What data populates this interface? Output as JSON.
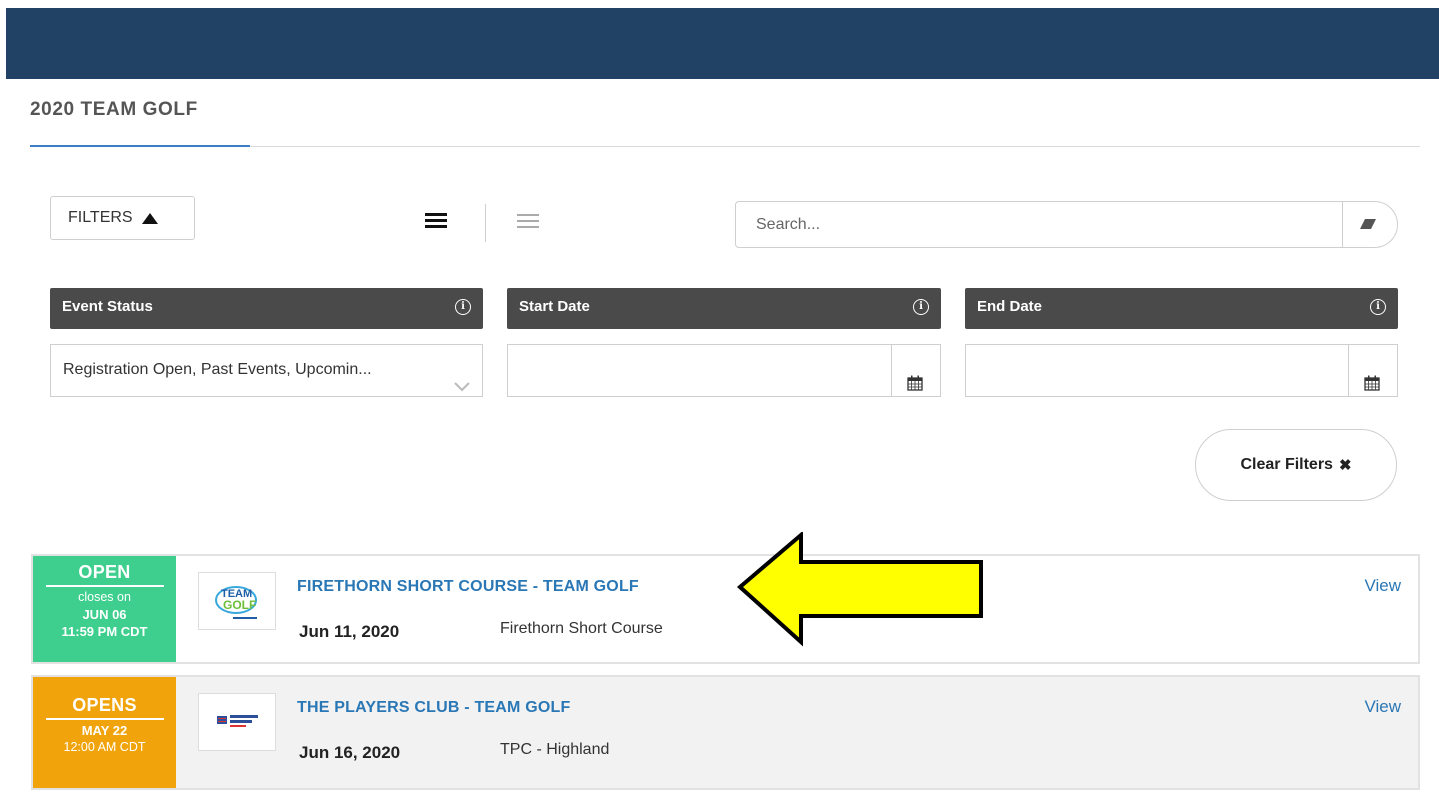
{
  "page_title": "2020 TEAM GOLF",
  "toolbar": {
    "filters_label": "FILTERS",
    "search_placeholder": "Search...",
    "search_value": ""
  },
  "filters": [
    {
      "header": "Event Status",
      "value": "Registration Open, Past Events, Upcomin..."
    },
    {
      "header": "Start Date",
      "value": ""
    },
    {
      "header": "End Date",
      "value": ""
    }
  ],
  "clear_filters_label": "Clear Filters",
  "events": [
    {
      "badge": {
        "status": "OPEN",
        "line1": "closes on",
        "line2": "JUN 06",
        "line3": "11:59 PM CDT",
        "color": "#3ecf8e"
      },
      "title": "FIRETHORN SHORT COURSE - TEAM GOLF",
      "date": "Jun 11, 2020",
      "venue": "Firethorn Short Course",
      "view_label": "View"
    },
    {
      "badge": {
        "status": "OPENS",
        "line1": "MAY 22",
        "line2": "12:00 AM CDT",
        "color": "#f0a30a"
      },
      "title": "THE PLAYERS CLUB - TEAM GOLF",
      "date": "Jun 16, 2020",
      "venue": "TPC - Highland",
      "view_label": "View"
    }
  ],
  "colors": {
    "topbar": "#214264",
    "accent": "#3b7fc4",
    "link": "#2a77b5",
    "filter_header": "#4a4a4a",
    "annotation_arrow": "#ffff00"
  }
}
